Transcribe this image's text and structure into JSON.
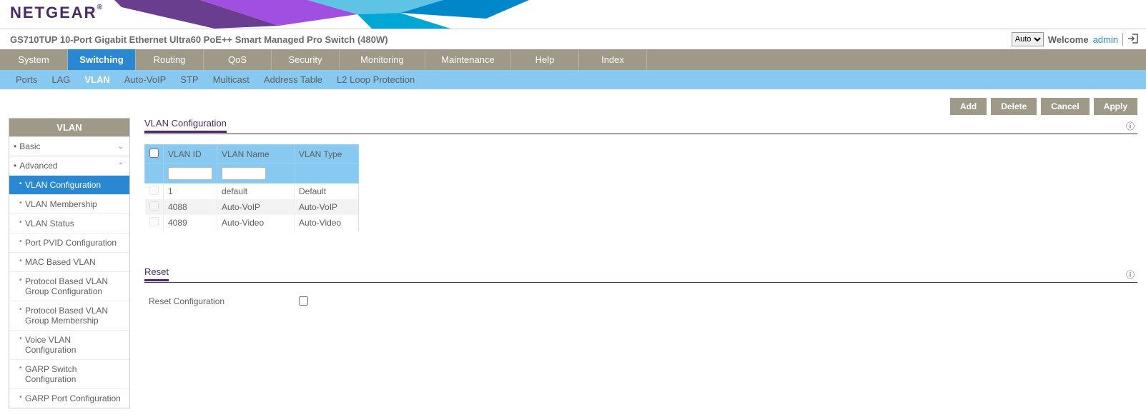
{
  "brand": "NETGEAR",
  "product_title": "GS710TUP 10-Port Gigabit Ethernet Ultra60 PoE++ Smart Managed Pro Switch (480W)",
  "lang_select": "Auto",
  "welcome_label": "Welcome",
  "welcome_user": "admin",
  "nav_primary": [
    {
      "label": "System"
    },
    {
      "label": "Switching",
      "active": true
    },
    {
      "label": "Routing"
    },
    {
      "label": "QoS"
    },
    {
      "label": "Security"
    },
    {
      "label": "Monitoring"
    },
    {
      "label": "Maintenance"
    },
    {
      "label": "Help"
    },
    {
      "label": "Index"
    }
  ],
  "nav_secondary": [
    {
      "label": "Ports"
    },
    {
      "label": "LAG"
    },
    {
      "label": "VLAN",
      "active": true
    },
    {
      "label": "Auto-VoIP"
    },
    {
      "label": "STP"
    },
    {
      "label": "Multicast"
    },
    {
      "label": "Address Table"
    },
    {
      "label": "L2 Loop Protection"
    }
  ],
  "actions": {
    "add": "Add",
    "delete": "Delete",
    "cancel": "Cancel",
    "apply": "Apply"
  },
  "sidebar": {
    "title": "VLAN",
    "sections": [
      {
        "label": "Basic",
        "expanded": false
      },
      {
        "label": "Advanced",
        "expanded": true
      }
    ],
    "advanced_items": [
      {
        "label": "VLAN Configuration",
        "active": true
      },
      {
        "label": "VLAN Membership"
      },
      {
        "label": "VLAN Status"
      },
      {
        "label": "Port PVID Configuration"
      },
      {
        "label": "MAC Based VLAN"
      },
      {
        "label": "Protocol Based VLAN Group Configuration"
      },
      {
        "label": "Protocol Based VLAN Group Membership"
      },
      {
        "label": "Voice VLAN Configuration"
      },
      {
        "label": "GARP Switch Configuration"
      },
      {
        "label": "GARP Port Configuration"
      }
    ]
  },
  "content": {
    "section1_title": "VLAN Configuration",
    "table": {
      "headers": {
        "id": "VLAN ID",
        "name": "VLAN Name",
        "type": "VLAN Type"
      },
      "rows": [
        {
          "id": "1",
          "name": "default",
          "type": "Default"
        },
        {
          "id": "4088",
          "name": "Auto-VoIP",
          "type": "Auto-VoIP"
        },
        {
          "id": "4089",
          "name": "Auto-Video",
          "type": "Auto-Video"
        }
      ]
    },
    "section2_title": "Reset",
    "reset_label": "Reset Configuration"
  }
}
